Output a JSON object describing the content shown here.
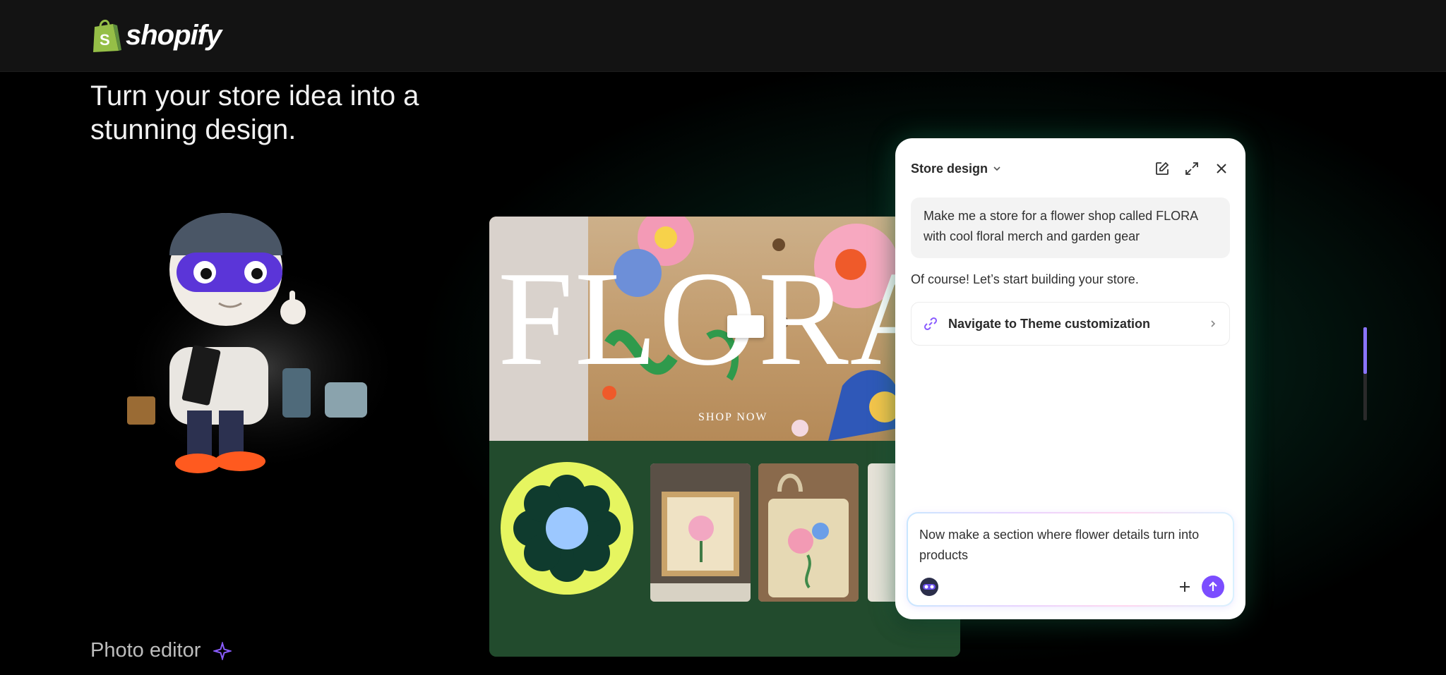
{
  "brand": {
    "name": "shopify",
    "accent": "#95bf47"
  },
  "hero": {
    "headline": "Turn your store idea into a stunning design."
  },
  "feature": {
    "label": "Photo editor",
    "icon": "sparkle-icon"
  },
  "store_preview": {
    "brand_word": "FLORA",
    "cta": "SHOP NOW"
  },
  "chat": {
    "title": "Store design",
    "actions": [
      "edit-icon",
      "expand-icon",
      "close-icon"
    ],
    "user_message": "Make me a store for a flower shop called FLORA with cool floral merch and garden gear",
    "assistant_message": "Of course! Let’s start building your store.",
    "action_card": {
      "label": "Navigate to Theme customization",
      "icon": "link-icon"
    },
    "composer": {
      "text": "Now make a section where flower details turn into products",
      "send_color": "#7b4dff"
    }
  },
  "scroll": {
    "position": 0.5
  }
}
